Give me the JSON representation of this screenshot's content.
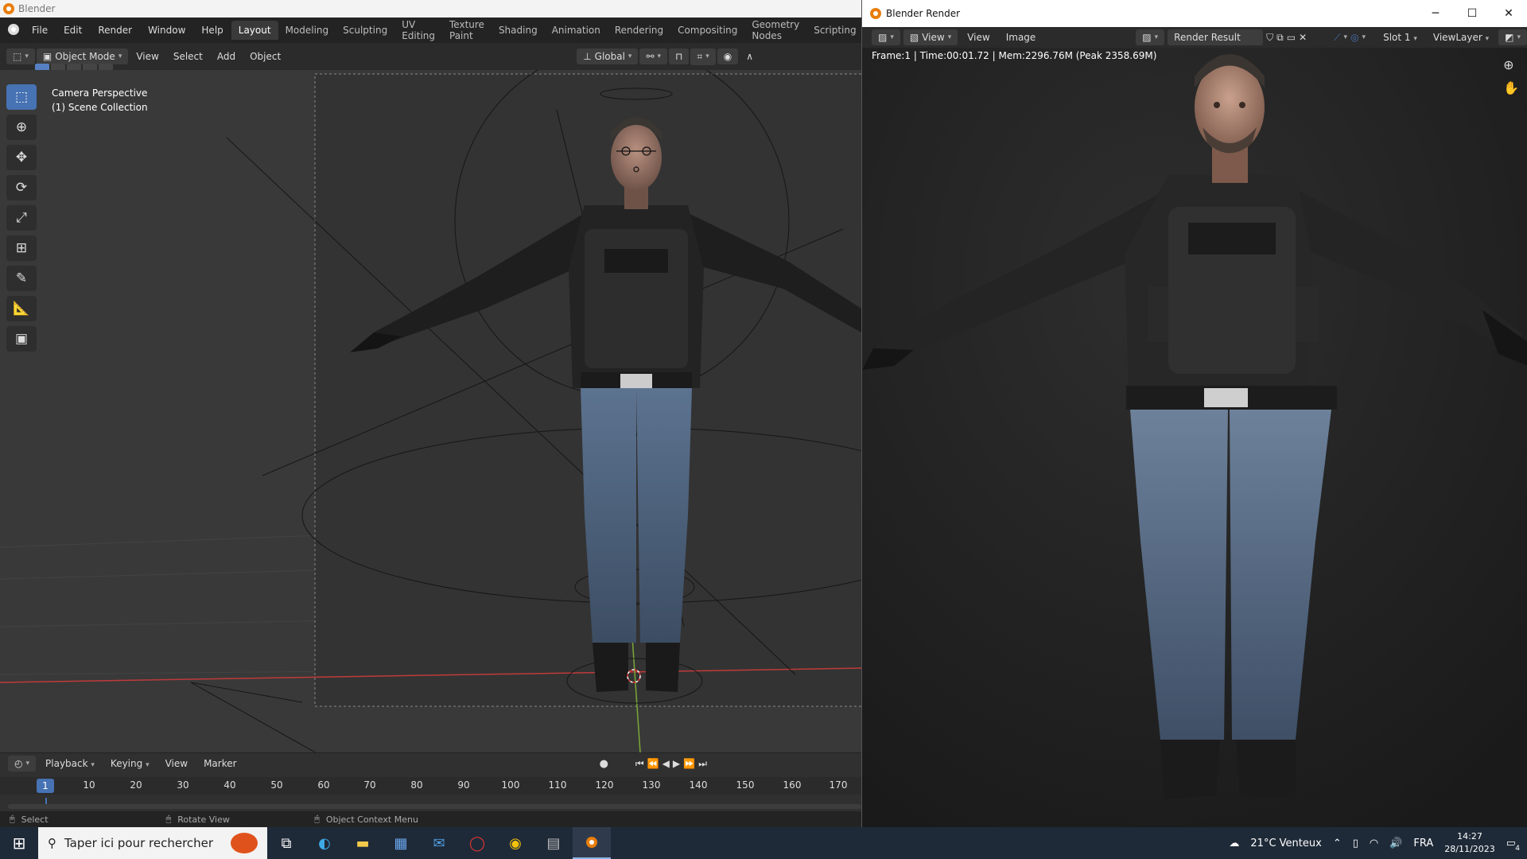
{
  "main_window": {
    "title": "Blender",
    "menu": [
      "File",
      "Edit",
      "Render",
      "Window",
      "Help"
    ],
    "workspaces": [
      "Layout",
      "Modeling",
      "Sculpting",
      "UV Editing",
      "Texture Paint",
      "Shading",
      "Animation",
      "Rendering",
      "Compositing",
      "Geometry Nodes",
      "Scripting",
      "+"
    ],
    "active_workspace": "Layout",
    "header": {
      "mode": "Object Mode",
      "menus": [
        "View",
        "Select",
        "Add",
        "Object"
      ],
      "orientation": "Global"
    },
    "viewport_info": {
      "line1": "Camera Perspective",
      "line2": "(1) Scene Collection"
    },
    "tools": [
      "select-box-icon",
      "cursor-icon",
      "move-icon",
      "rotate-icon",
      "scale-icon",
      "transform-icon",
      "annotate-icon",
      "measure-icon",
      "add-cube-icon"
    ]
  },
  "timeline": {
    "menus": [
      "Playback",
      "Keying",
      "View",
      "Marker"
    ],
    "current_frame": "1",
    "ticks": [
      "10",
      "20",
      "30",
      "40",
      "50",
      "60",
      "70",
      "80",
      "90",
      "100",
      "110",
      "120",
      "130",
      "140",
      "150",
      "160",
      "170"
    ]
  },
  "statusbar": {
    "select": "Select",
    "rotate": "Rotate View",
    "context": "Object Context Menu"
  },
  "render_window": {
    "title": "Blender Render",
    "header_menus": [
      "View",
      "View",
      "Image"
    ],
    "image_name": "Render Result",
    "slot": "Slot 1",
    "view_layer": "ViewLayer",
    "info": "Frame:1 | Time:00:01.72 | Mem:2296.76M (Peak 2358.69M)"
  },
  "taskbar": {
    "search_placeholder": "Taper ici pour rechercher",
    "weather": "21°C  Venteux",
    "lang": "FRA",
    "time": "14:27",
    "date": "28/11/2023",
    "notifications": "4"
  },
  "colors": {
    "accent": "#4772b3",
    "blender_orange": "#e87d0d",
    "x_axis": "#c03a3a",
    "y_axis": "#7aa838"
  }
}
